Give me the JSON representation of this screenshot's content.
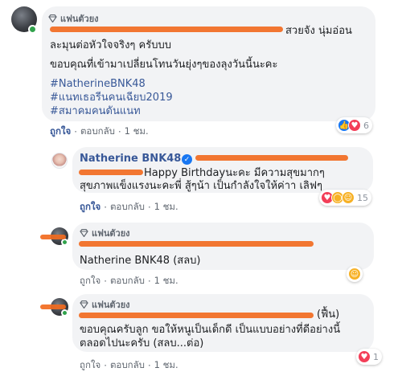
{
  "colors": {
    "link": "#385898",
    "bubble": "#f2f3f5",
    "redaction": "#f26b1f",
    "online": "#31a24c"
  },
  "comment1": {
    "fan_badge": "แฟนตัวยง",
    "line1_tail": "สวยจัง นุ่มอ่อน",
    "line2": "ละมุนต่อหัวใจจริงๆ ครับบบ",
    "line3": "ขอบคุณที่เข้ามาเปลี่ยนโทนวันยุ่งๆของลุงวันนี้นะคะ",
    "hashtags": [
      "#NatherineBNK48",
      "#แนทเธอรีนคนเฉียบ2019",
      "#สมาคมคนดันแนท"
    ],
    "actions": {
      "like": "ถูกใจ",
      "reply": "ตอบกลับ",
      "time": "1 ชม."
    },
    "reaction_count": "6"
  },
  "reply1": {
    "author": "Natherine BNK48",
    "text_line1": "Happy Birthdayนะคะ มีความสุขมากๆ",
    "text_line2": "สุขภาพแข็งแรงนะคะพี่ สู้ๆน้า เป็นกำลังใจให้ค่าา เลิฟๆ",
    "actions": {
      "like": "ถูกใจ",
      "reply": "ตอบกลับ",
      "time": "1 ชม."
    },
    "reaction_count": "15"
  },
  "reply2": {
    "fan_badge": "แฟนตัวยง",
    "text": "Natherine BNK48 (สลบ)",
    "actions": {
      "like": "ถูกใจ",
      "reply": "ตอบกลับ",
      "time": "1 ชม."
    }
  },
  "reply3": {
    "fan_badge": "แฟนตัวยง",
    "tail": "(ฟื้น)",
    "text_line1": "ขอบคุณครับลูก ขอให้หนูเป็นเด็กดี เป็นแบบอย่างที่ดีอย่างนี้",
    "text_line2": "ตลอดไปนะครับ (สลบ...ต่อ)",
    "actions": {
      "like": "ถูกใจ",
      "reply": "ตอบกลับ",
      "time": "1 ชม."
    },
    "reaction_count": "1"
  },
  "icons": {
    "fan": "diamond-icon",
    "verified": "verified-check-icon"
  }
}
